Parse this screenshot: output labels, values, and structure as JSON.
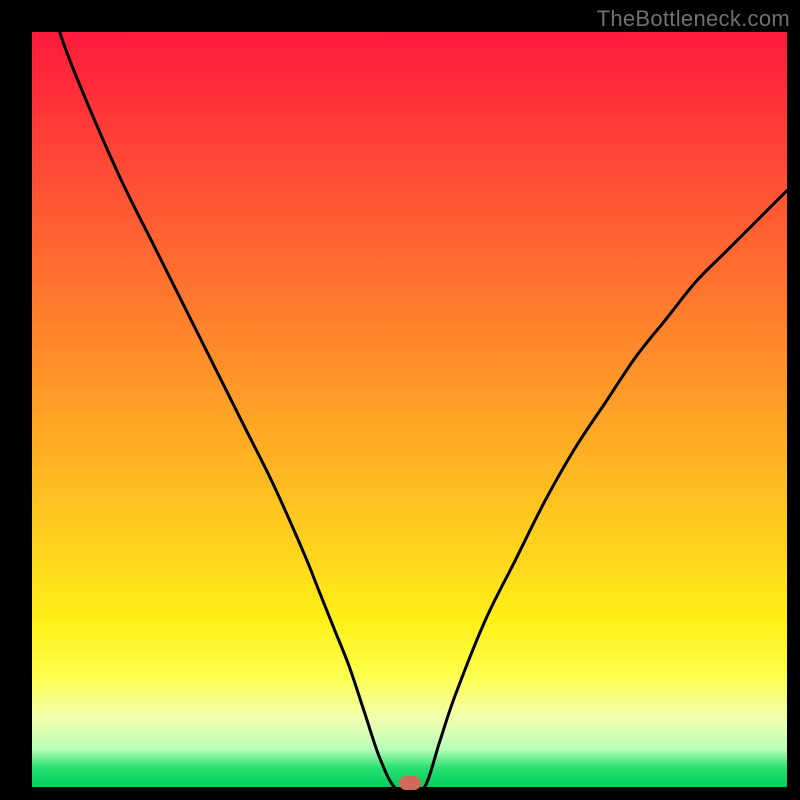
{
  "watermark": "TheBottleneck.com",
  "chart_data": {
    "type": "line",
    "title": "",
    "xlabel": "",
    "ylabel": "",
    "xlim": [
      0,
      100
    ],
    "ylim": [
      0,
      100
    ],
    "grid": false,
    "x": [
      0,
      4,
      8,
      12,
      16,
      20,
      24,
      28,
      32,
      36,
      38,
      40,
      42,
      44,
      46,
      48,
      50,
      52,
      54,
      56,
      60,
      64,
      68,
      72,
      76,
      80,
      84,
      88,
      92,
      96,
      100
    ],
    "y": [
      112,
      99,
      89,
      80,
      72,
      64,
      56,
      48,
      40,
      31,
      26,
      21,
      16,
      10,
      4,
      0,
      0,
      0,
      6,
      12,
      22,
      30,
      38,
      45,
      51,
      57,
      62,
      67,
      71,
      75,
      79
    ],
    "marker": {
      "x": 50,
      "y": 0
    },
    "colors": {
      "line": "#000000",
      "marker": "#d06a5a",
      "gradient_top": "#ff1a3c",
      "gradient_bottom": "#00d060"
    }
  }
}
